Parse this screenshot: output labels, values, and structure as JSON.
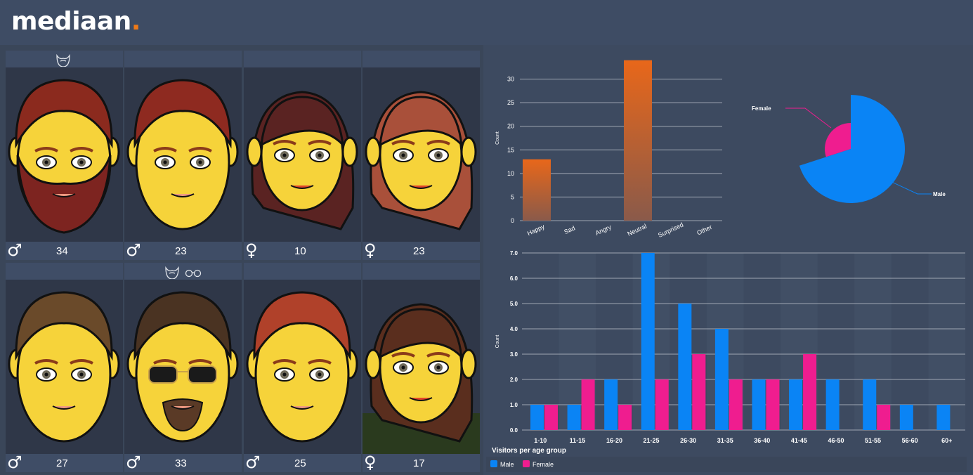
{
  "brand": {
    "name": "mediaan",
    "dot": ".",
    "accent": "#f07a17"
  },
  "visitors": [
    {
      "sex_icon": "male-symbol-icon",
      "sex": "♂",
      "age": "34",
      "accessories": [
        "beard-icon"
      ],
      "hair": "#8b2a1e",
      "beard": true
    },
    {
      "sex_icon": "male-symbol-icon",
      "sex": "♂",
      "age": "23",
      "accessories": [],
      "hair": "#8e2a20"
    },
    {
      "sex_icon": "female-symbol-icon",
      "sex": "♀",
      "age": "10",
      "accessories": [],
      "hair": "#5a2322"
    },
    {
      "sex_icon": "female-symbol-icon",
      "sex": "♀",
      "age": "23",
      "accessories": [],
      "hair": "#a9503a"
    },
    {
      "sex_icon": "male-symbol-icon",
      "sex": "♂",
      "age": "27",
      "accessories": [],
      "hair": "#6a4a2a"
    },
    {
      "sex_icon": "male-symbol-icon",
      "sex": "♂",
      "age": "33",
      "accessories": [
        "beard-icon",
        "glasses-icon"
      ],
      "hair": "#4a3322"
    },
    {
      "sex_icon": "male-symbol-icon",
      "sex": "♂",
      "age": "25",
      "accessories": [],
      "hair": "#b0412a"
    },
    {
      "sex_icon": "female-symbol-icon",
      "sex": "♀",
      "age": "17",
      "accessories": [],
      "hair": "#5a2e1e"
    }
  ],
  "chart_data": [
    {
      "type": "bar",
      "categories": [
        "Happy",
        "Sad",
        "Angry",
        "Neutral",
        "Surprised",
        "Other"
      ],
      "values": [
        13,
        0,
        0,
        34,
        0,
        0
      ],
      "ylabel": "Count",
      "ylim": [
        0,
        35
      ],
      "yticks": [
        "0",
        "5",
        "10",
        "15",
        "20",
        "25",
        "30"
      ],
      "color": "#e8671a",
      "grid": true
    },
    {
      "type": "pie",
      "labels": [
        "Female",
        "Male"
      ],
      "values": [
        3,
        7
      ],
      "colors": [
        "#ef1d8f",
        "#0a84f5"
      ]
    },
    {
      "type": "bar",
      "title": "Visitors per age group",
      "categories": [
        "1-10",
        "11-15",
        "16-20",
        "21-25",
        "26-30",
        "31-35",
        "36-40",
        "41-45",
        "46-50",
        "51-55",
        "56-60",
        "60+"
      ],
      "series": [
        {
          "name": "Male",
          "color": "#0a84f5",
          "values": [
            1,
            1,
            2,
            7,
            5,
            4,
            2,
            2,
            2,
            2,
            1,
            1
          ]
        },
        {
          "name": "Female",
          "color": "#ef1d8f",
          "values": [
            1,
            2,
            1,
            2,
            3,
            2,
            2,
            3,
            0,
            1,
            0,
            0
          ]
        }
      ],
      "ylabel": "Count",
      "ylim": [
        0,
        7
      ],
      "yticks": [
        "0.0",
        "1.0",
        "2.0",
        "3.0",
        "4.0",
        "5.0",
        "6.0",
        "7.0"
      ],
      "legend": "bottom-left",
      "grid": true
    }
  ]
}
